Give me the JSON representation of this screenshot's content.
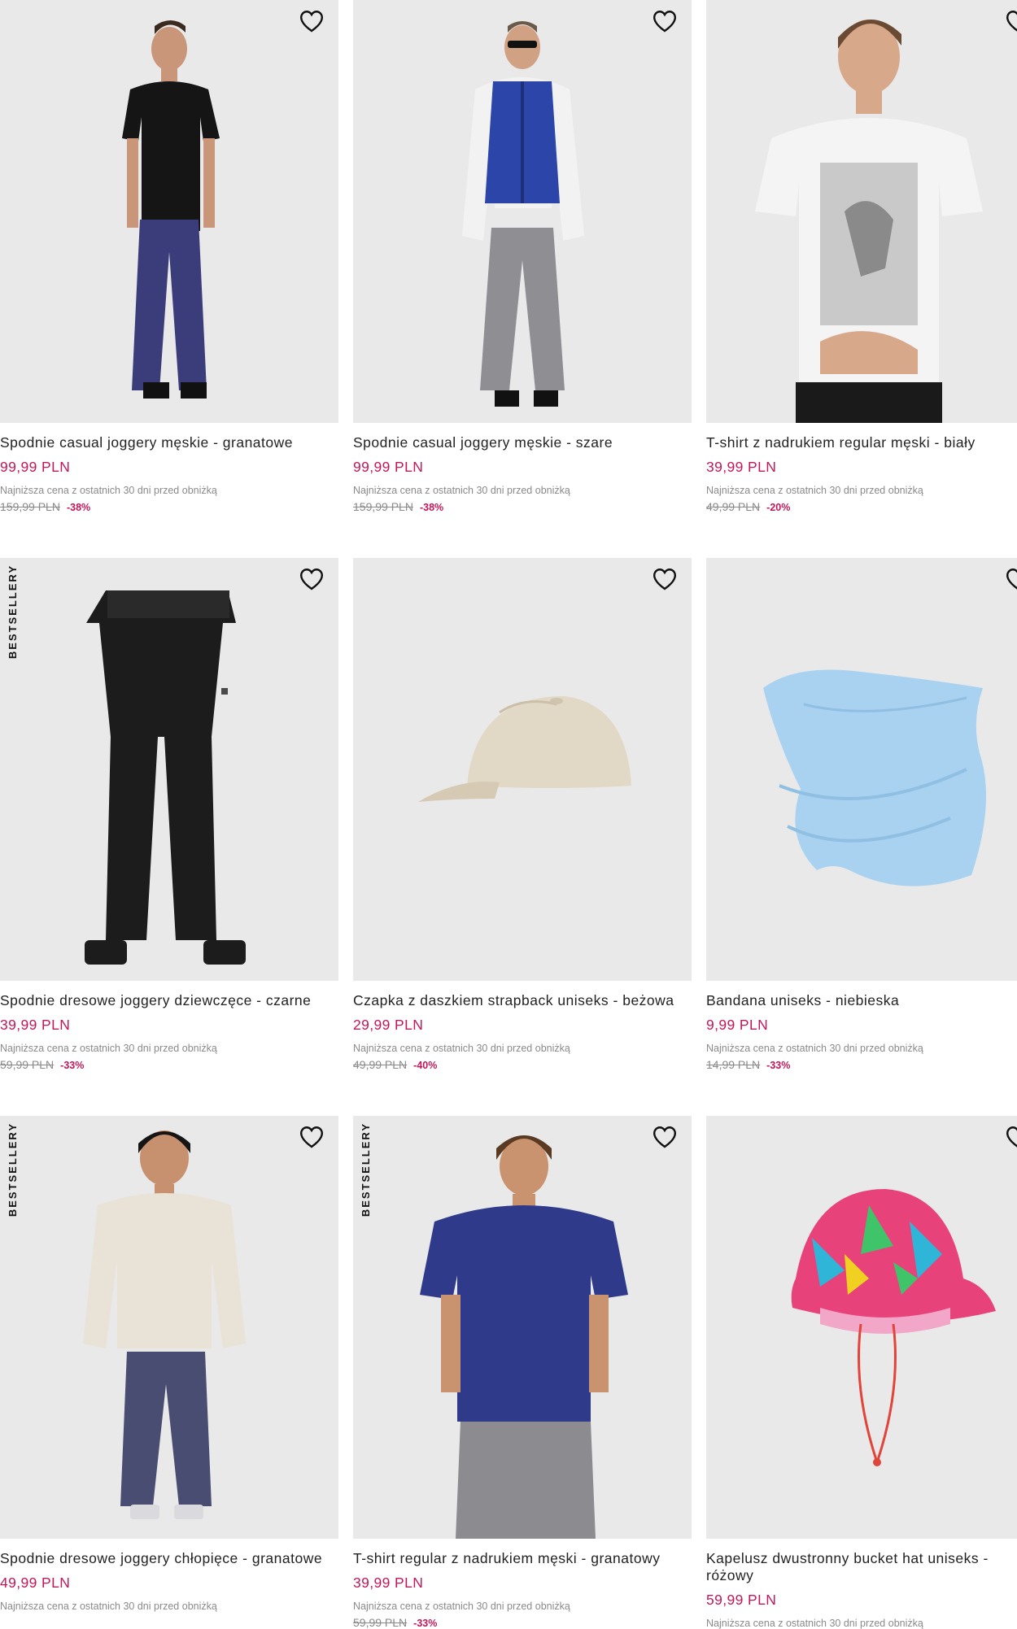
{
  "products": [
    {
      "name": "Spodnie casual joggery męskie - granatowe",
      "price": "99,99 PLN",
      "lowest_note": "Najniższa cena z ostatnich 30 dni przed obniżką",
      "old_price": "159,99 PLN",
      "discount": "-38%",
      "badge": "",
      "image": "man-black-tshirt-navy-joggers"
    },
    {
      "name": "Spodnie casual joggery męskie - szare",
      "price": "99,99 PLN",
      "lowest_note": "Najniższa cena z ostatnich 30 dni przed obniżką",
      "old_price": "159,99 PLN",
      "discount": "-38%",
      "badge": "",
      "image": "man-blue-vest-grey-joggers"
    },
    {
      "name": "T-shirt z nadrukiem regular męski - biały",
      "price": "39,99 PLN",
      "lowest_note": "Najniższa cena z ostatnich 30 dni przed obniżką",
      "old_price": "49,99 PLN",
      "discount": "-20%",
      "badge": "",
      "image": "man-white-print-tshirt"
    },
    {
      "name": "Spodnie dresowe joggery dziewczęce - czarne",
      "price": "39,99 PLN",
      "lowest_note": "Najniższa cena z ostatnich 30 dni przed obniżką",
      "old_price": "59,99 PLN",
      "discount": "-33%",
      "badge": "BESTSELLERY",
      "image": "black-sweatpants"
    },
    {
      "name": "Czapka z daszkiem strapback uniseks - beżowa",
      "price": "29,99 PLN",
      "lowest_note": "Najniższa cena z ostatnich 30 dni przed obniżką",
      "old_price": "49,99 PLN",
      "discount": "-40%",
      "badge": "",
      "image": "beige-cap"
    },
    {
      "name": "Bandana uniseks - niebieska",
      "price": "9,99 PLN",
      "lowest_note": "Najniższa cena z ostatnich 30 dni przed obniżką",
      "old_price": "14,99 PLN",
      "discount": "-33%",
      "badge": "",
      "image": "blue-bandana"
    },
    {
      "name": "Spodnie dresowe joggery chłopięce - granatowe",
      "price": "49,99 PLN",
      "lowest_note": "Najniższa cena z ostatnich 30 dni przed obniżką",
      "old_price": "",
      "discount": "",
      "badge": "BESTSELLERY",
      "image": "boy-cream-sweatshirt-navy-joggers"
    },
    {
      "name": "T-shirt regular z nadrukiem męski - granatowy",
      "price": "39,99 PLN",
      "lowest_note": "Najniższa cena z ostatnich 30 dni przed obniżką",
      "old_price": "59,99 PLN",
      "discount": "-33%",
      "badge": "BESTSELLERY",
      "image": "man-navy-tshirt"
    },
    {
      "name": "Kapelusz dwustronny bucket hat uniseks - różowy",
      "price": "59,99 PLN",
      "lowest_note": "Najniższa cena z ostatnich 30 dni przed obniżką",
      "old_price": "",
      "discount": "",
      "badge": "",
      "image": "pink-bucket-hat"
    }
  ],
  "colors": {
    "price": "#c0185b",
    "tile_bg": "#e9e9e9",
    "muted": "#8a8a8a"
  }
}
